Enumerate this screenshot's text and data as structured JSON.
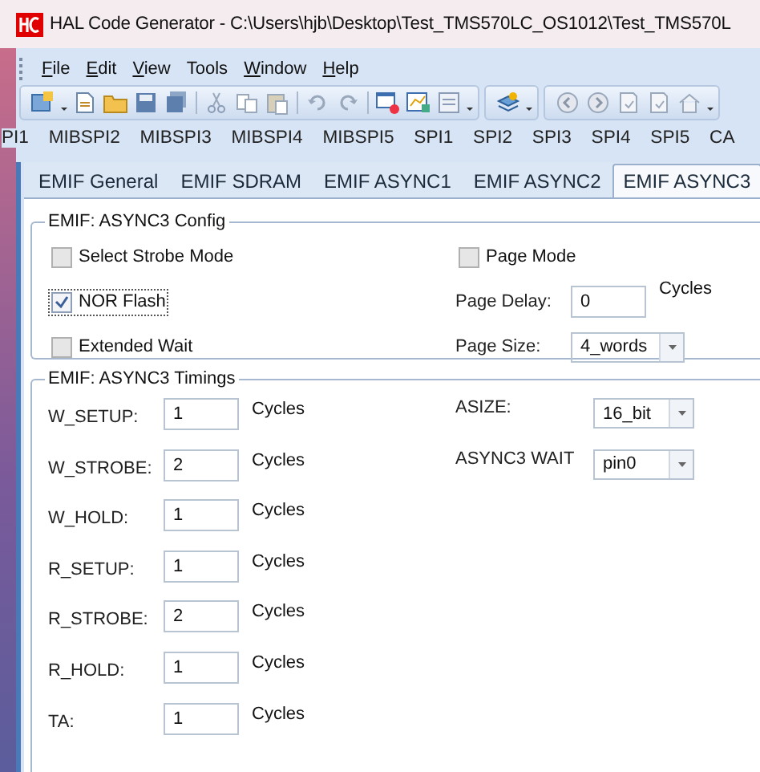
{
  "window": {
    "title": "HAL Code Generator - C:\\Users\\hjb\\Desktop\\Test_TMS570LC_OS1012\\Test_TMS570L"
  },
  "menu": [
    {
      "label": "File",
      "underlined": true
    },
    {
      "label": "Edit",
      "underlined": true
    },
    {
      "label": "View",
      "underlined": true
    },
    {
      "label": "Tools",
      "underlined": false
    },
    {
      "label": "Window",
      "underlined": true
    },
    {
      "label": "Help",
      "underlined": true
    }
  ],
  "peripheral_tabs": [
    {
      "label": "PI1",
      "selected": false
    },
    {
      "label": "MIBSPI2",
      "selected": false
    },
    {
      "label": "MIBSPI3",
      "selected": false
    },
    {
      "label": "MIBSPI4",
      "selected": false
    },
    {
      "label": "MIBSPI5",
      "selected": false
    },
    {
      "label": "SPI1",
      "selected": false
    },
    {
      "label": "SPI2",
      "selected": false
    },
    {
      "label": "SPI3",
      "selected": false
    },
    {
      "label": "SPI4",
      "selected": false
    },
    {
      "label": "SPI5",
      "selected": false
    },
    {
      "label": "CA",
      "selected": false
    }
  ],
  "emif_tabs": [
    {
      "label": "EMIF General",
      "selected": false
    },
    {
      "label": "EMIF SDRAM",
      "selected": false
    },
    {
      "label": "EMIF ASYNC1",
      "selected": false
    },
    {
      "label": "EMIF ASYNC2",
      "selected": false
    },
    {
      "label": "EMIF ASYNC3",
      "selected": true
    }
  ],
  "config_group": {
    "title": "EMIF: ASYNC3 Config",
    "left": [
      {
        "kind": "checkbox",
        "label": "Select Strobe Mode",
        "checked": false,
        "focused": false
      },
      {
        "kind": "checkbox",
        "label": "NOR Flash",
        "checked": true,
        "focused": true
      },
      {
        "kind": "checkbox",
        "label": "Extended Wait",
        "checked": false,
        "focused": false
      }
    ],
    "right": [
      {
        "kind": "checkbox",
        "label": "Page Mode",
        "checked": false,
        "focused": false
      },
      {
        "kind": "input",
        "label": "Page Delay:",
        "value": "0",
        "unit": "Cycles"
      },
      {
        "kind": "select",
        "label": "Page Size:",
        "value": "4_words"
      }
    ]
  },
  "timings_group": {
    "title": "EMIF: ASYNC3 Timings",
    "rows": [
      {
        "label": "W_SETUP:",
        "value": "1",
        "unit": "Cycles"
      },
      {
        "label": "W_STROBE:",
        "value": "2",
        "unit": "Cycles"
      },
      {
        "label": "W_HOLD:",
        "value": "1",
        "unit": "Cycles"
      },
      {
        "label": "R_SETUP:",
        "value": "1",
        "unit": "Cycles"
      },
      {
        "label": "R_STROBE:",
        "value": "2",
        "unit": "Cycles"
      },
      {
        "label": "R_HOLD:",
        "value": "1",
        "unit": "Cycles"
      },
      {
        "label": "TA:",
        "value": "1",
        "unit": "Cycles"
      }
    ],
    "right": [
      {
        "label": "ASIZE:",
        "value": "16_bit"
      },
      {
        "label": "ASYNC3 WAIT",
        "value": "pin0"
      }
    ]
  }
}
